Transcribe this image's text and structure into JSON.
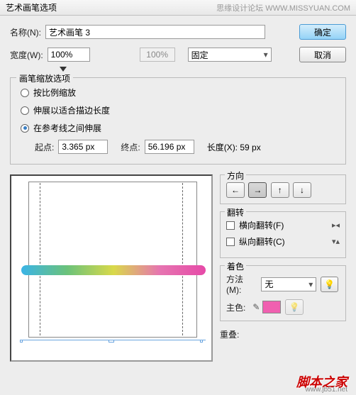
{
  "title": "艺术画笔选项",
  "watermark_top": "思缘设计论坛  WWW.MISSYUAN.COM",
  "name_label": "名称(N):",
  "name_value": "艺术画笔 3",
  "ok": "确定",
  "cancel": "取消",
  "width_label": "宽度(W):",
  "width_value": "100%",
  "width_display": "100%",
  "fixed": "固定",
  "scale_group": "画笔缩放选项",
  "radio1": "按比例缩放",
  "radio2": "伸展以适合描边长度",
  "radio3": "在参考线之间伸展",
  "start_label": "起点:",
  "start_value": "3.365 px",
  "end_label": "终点:",
  "end_value": "56.196 px",
  "length_label": "长度(X): 59 px",
  "direction": "方向",
  "flip": "翻转",
  "flip_h": "横向翻转(F)",
  "flip_v": "纵向翻转(C)",
  "colorize": "着色",
  "method_label": "方法(M):",
  "method_value": "无",
  "keycolor_label": "主色:",
  "overlap_label": "重叠:",
  "arrows": {
    "l": "←",
    "r": "→",
    "u": "↑",
    "d": "↓"
  },
  "watermark": "脚本之家",
  "watermark_url": "www.jb51.net"
}
